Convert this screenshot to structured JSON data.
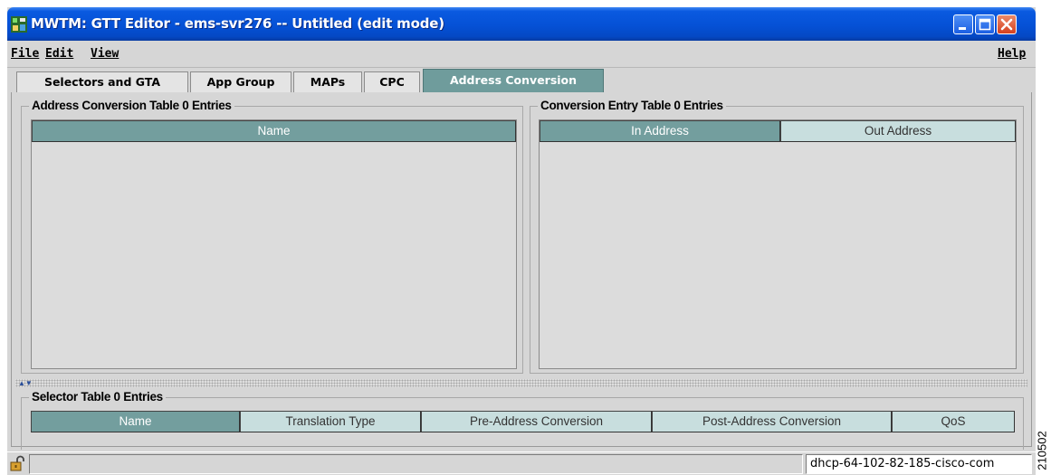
{
  "window": {
    "title": "MWTM:  GTT Editor - ems-svr276 -- Untitled (edit mode)"
  },
  "menu": {
    "file": "File",
    "edit": "Edit",
    "view": "View",
    "help": "Help"
  },
  "tabs": [
    {
      "label": "Selectors and GTA",
      "active": false
    },
    {
      "label": "App Group",
      "active": false
    },
    {
      "label": "MAPs",
      "active": false
    },
    {
      "label": "CPC",
      "active": false
    },
    {
      "label": "Address Conversion",
      "active": true
    }
  ],
  "address_conversion_table": {
    "title": "Address Conversion Table  0 Entries",
    "columns": [
      "Name"
    ],
    "rows": []
  },
  "conversion_entry_table": {
    "title": "Conversion Entry Table  0 Entries",
    "columns": [
      "In Address",
      "Out Address"
    ],
    "rows": []
  },
  "selector_table": {
    "title": "Selector Table  0 Entries",
    "columns": [
      "Name",
      "Translation Type",
      "Pre-Address Conversion",
      "Post-Address Conversion",
      "QoS"
    ],
    "rows": []
  },
  "status": {
    "host": "dhcp-64-102-82-185-cisco-com"
  },
  "figure_id": "210502",
  "colors": {
    "titlebar": "#0551d6",
    "active_tab": "#6f9c9c",
    "sorted_header": "#739e9e",
    "header": "#c8dede",
    "panel": "#d6d6d6"
  },
  "icons": [
    "app-icon",
    "minimize-icon",
    "maximize-icon",
    "close-icon",
    "splitter-arrows-icon",
    "lock-icon"
  ]
}
